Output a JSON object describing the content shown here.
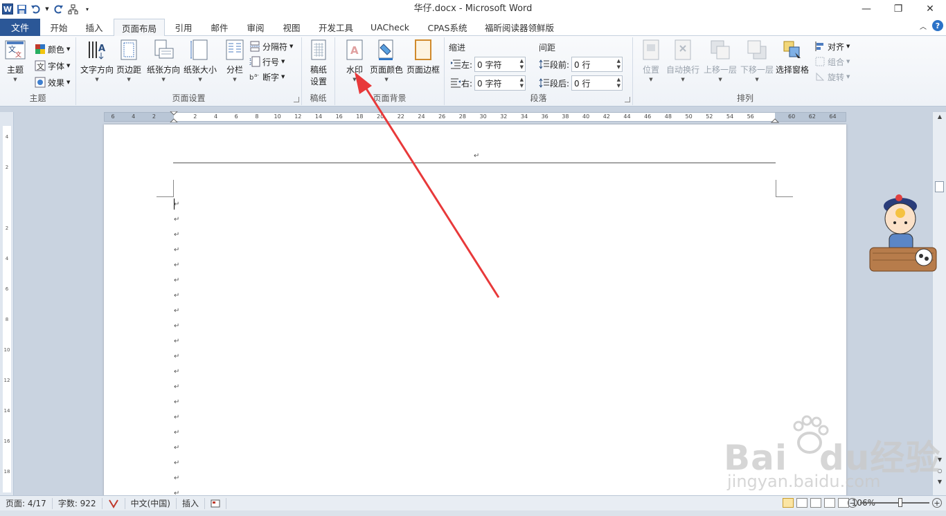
{
  "window": {
    "title": "华仔.docx - Microsoft Word"
  },
  "qat": {
    "app_icon_letter": "W"
  },
  "tabs": {
    "file": "文件",
    "items": [
      "开始",
      "插入",
      "页面布局",
      "引用",
      "邮件",
      "审阅",
      "视图",
      "开发工具",
      "UACheck",
      "CPAS系统",
      "福昕阅读器领鲜版"
    ],
    "active_index": 2
  },
  "ribbon": {
    "theme_group": {
      "label": "主题",
      "theme_btn": "主题",
      "colors": "颜色",
      "fonts": "字体",
      "effects": "效果"
    },
    "page_setup": {
      "label": "页面设置",
      "text_direction": "文字方向",
      "margins": "页边距",
      "orientation": "纸张方向",
      "size": "纸张大小",
      "columns": "分栏",
      "breaks": "分隔符",
      "line_numbers": "行号",
      "hyphenation": "断字"
    },
    "manuscript": {
      "label": "稿纸",
      "btn_line1": "稿纸",
      "btn_line2": "设置"
    },
    "page_background": {
      "label": "页面背景",
      "watermark": "水印",
      "page_color": "页面颜色",
      "page_borders": "页面边框"
    },
    "paragraph": {
      "label": "段落",
      "indent_title": "缩进",
      "spacing_title": "间距",
      "left_label": "左:",
      "left_value": "0 字符",
      "right_label": "右:",
      "right_value": "0 字符",
      "before_label": "段前:",
      "before_value": "0 行",
      "after_label": "段后:",
      "after_value": "0 行"
    },
    "arrange": {
      "label": "排列",
      "position": "位置",
      "wrap_text": "自动换行",
      "bring_forward": "上移一层",
      "send_backward": "下移一层",
      "selection_pane": "选择窗格",
      "align": "对齐",
      "group": "组合",
      "rotate": "旋转"
    }
  },
  "ruler": {
    "h_numbers": [
      "6",
      "4",
      "2",
      "",
      "2",
      "4",
      "6",
      "8",
      "10",
      "12",
      "14",
      "16",
      "18",
      "20",
      "22",
      "24",
      "26",
      "28",
      "30",
      "32",
      "34",
      "36",
      "38",
      "40",
      "42",
      "44",
      "46",
      "48",
      "50",
      "52",
      "54",
      "56",
      "",
      "60",
      "62",
      "64"
    ],
    "v_numbers": [
      "4",
      "2",
      "",
      "2",
      "4",
      "6",
      "8",
      "10",
      "12",
      "14",
      "16",
      "18"
    ],
    "tab_selector": "L"
  },
  "document": {
    "paragraph_mark": "↵"
  },
  "status": {
    "page": "页面: 4/17",
    "words": "字数: 922",
    "language": "中文(中国)",
    "mode": "插入",
    "zoom": "106%"
  },
  "watermark_overlay": {
    "brand": "Bai",
    "brand2": "du",
    "brand_cn": "经验",
    "url": "jingyan.baidu.com"
  },
  "colors": {
    "file_tab": "#2b5797",
    "arrow": "#e8393a",
    "help": "#2b72c7"
  }
}
